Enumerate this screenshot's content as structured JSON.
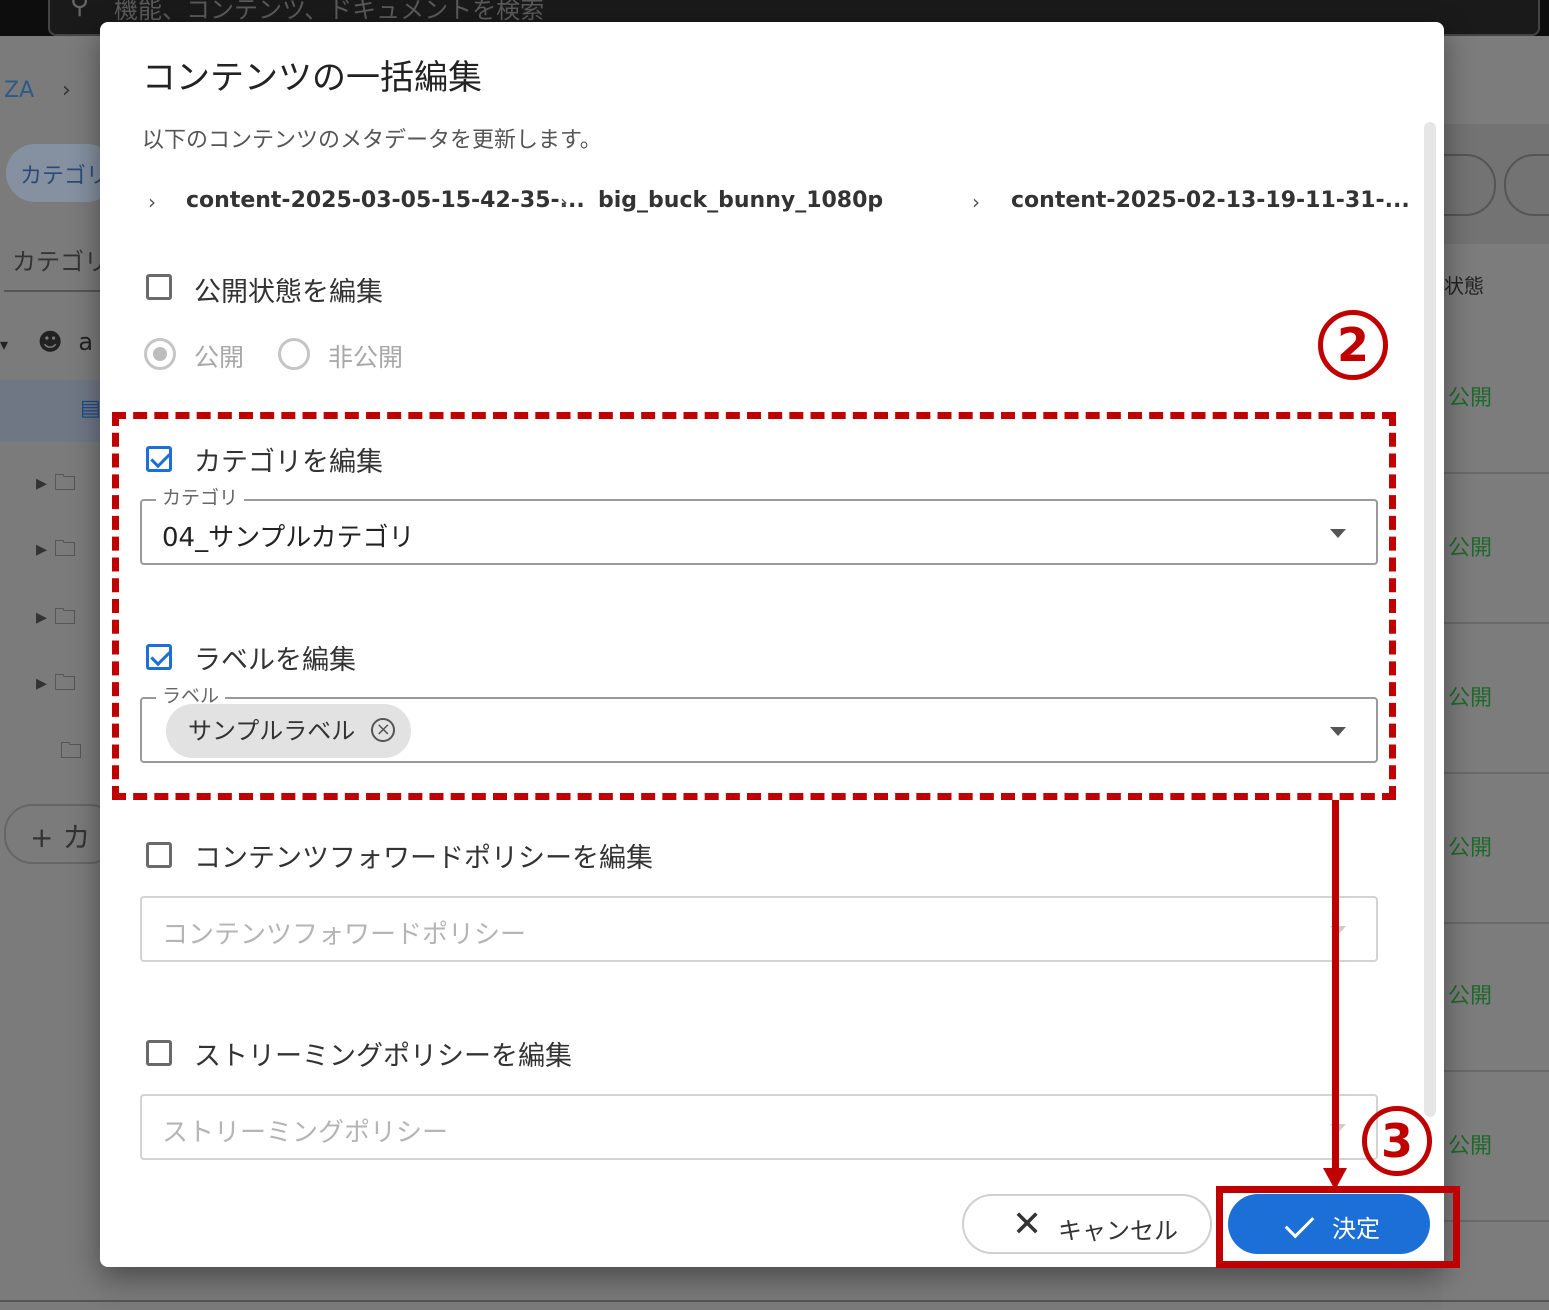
{
  "background": {
    "search_placeholder": "機能、コンテンツ、ドキュメントを検索",
    "breadcrumb_root": "ZA",
    "breadcrumb_sep": "›",
    "category_chip": "カテゴリ",
    "category_field": "カテゴリ",
    "tree_user_initial": "a",
    "add_button_label": "+ カ",
    "status_column_title": "状態",
    "row_status": "公開"
  },
  "dialog": {
    "title": "コンテンツの一括編集",
    "description": "以下のコンテンツのメタデータを更新します。",
    "contents": [
      "content-2025-03-05-15-42-35-...",
      "big_buck_bunny_1080p",
      "content-2025-02-13-19-11-31-..."
    ],
    "crumb_sep": "›",
    "publish": {
      "checkbox_label": "公開状態を編集",
      "checked": false,
      "options": [
        "公開",
        "非公開"
      ],
      "selected": "公開"
    },
    "category": {
      "checkbox_label": "カテゴリを編集",
      "checked": true,
      "field_label": "カテゴリ",
      "value": "04_サンプルカテゴリ"
    },
    "label": {
      "checkbox_label": "ラベルを編集",
      "checked": true,
      "field_label": "ラベル",
      "chips": [
        "サンプルラベル"
      ]
    },
    "forward_policy": {
      "checkbox_label": "コンテンツフォワードポリシーを編集",
      "checked": false,
      "placeholder": "コンテンツフォワードポリシー"
    },
    "streaming_policy": {
      "checkbox_label": "ストリーミングポリシーを編集",
      "checked": false,
      "placeholder": "ストリーミングポリシー"
    },
    "buttons": {
      "cancel": "キャンセル",
      "confirm": "決定"
    }
  },
  "annotations": {
    "step2": "2",
    "step3": "3",
    "color": "#c00000"
  },
  "colors": {
    "accent": "#1b6fd6",
    "annotation": "#c00000",
    "status_green": "#1e6a2a"
  }
}
